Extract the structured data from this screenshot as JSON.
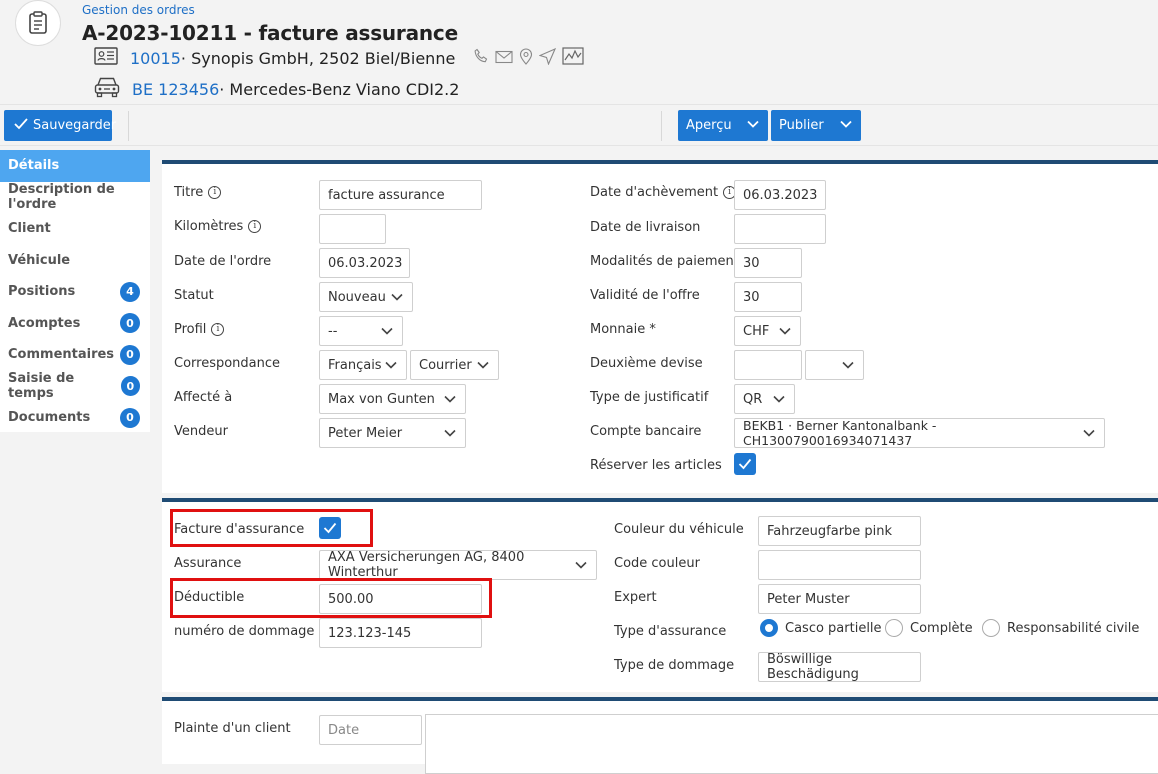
{
  "header": {
    "breadcrumb": "Gestion des ordres",
    "title": "A-2023-10211 - facture assurance",
    "client_number": "10015",
    "client_name": " · Synopis GmbH, 2502 Biel/Bienne",
    "vehicle_plate": "BE 123456",
    "vehicle_name": " · Mercedes-Benz Viano CDI2.2"
  },
  "toolbar": {
    "save_label": "Sauvegarder",
    "preview_label": "Aperçu",
    "publish_label": "Publier"
  },
  "sidebar": {
    "items": [
      {
        "label": "Détails",
        "badge": ""
      },
      {
        "label": "Description de l'ordre",
        "badge": ""
      },
      {
        "label": "Client",
        "badge": ""
      },
      {
        "label": "Véhicule",
        "badge": ""
      },
      {
        "label": "Positions",
        "badge": "4"
      },
      {
        "label": "Acomptes",
        "badge": "0"
      },
      {
        "label": "Commentaires",
        "badge": "0"
      },
      {
        "label": "Saisie de temps",
        "badge": "0"
      },
      {
        "label": "Documents",
        "badge": "0"
      }
    ]
  },
  "details": {
    "titre_label": "Titre",
    "titre_value": "facture assurance",
    "km_label": "Kilomètres",
    "km_value": "",
    "date_ordre_label": "Date de l'ordre",
    "date_ordre_value": "06.03.2023",
    "statut_label": "Statut",
    "statut_value": "Nouveau",
    "profil_label": "Profil",
    "profil_value": "--",
    "corresp_label": "Correspondance",
    "corresp_lang": "Français",
    "corresp_mode": "Courrier",
    "affecte_label": "Affecté à",
    "affecte_value": "Max von Gunten",
    "vendeur_label": "Vendeur",
    "vendeur_value": "Peter Meier",
    "date_ach_label": "Date d'achèvement",
    "date_ach_value": "06.03.2023",
    "date_liv_label": "Date de livraison",
    "date_liv_value": "",
    "modalites_label": "Modalités de paiement",
    "modalites_value": "30",
    "validite_label": "Validité de l'offre",
    "validite_value": "30",
    "monnaie_label": "Monnaie *",
    "monnaie_value": "CHF",
    "devise2_label": "Deuxième devise",
    "devise2_value": "",
    "devise2_select": "",
    "justif_label": "Type de justificatif",
    "justif_value": "QR",
    "compte_label": "Compte bancaire",
    "compte_value": "BEKB1 · Berner Kantonalbank - CH1300790016934071437",
    "reserver_label": "Réserver les articles"
  },
  "insurance": {
    "facture_label": "Facture d'assurance",
    "assurance_label": "Assurance",
    "assurance_value": "AXA Versicherungen AG, 8400 Winterthur",
    "deductible_label": "Déductible",
    "deductible_value": "500.00",
    "dommage_num_label": "numéro de dommage",
    "dommage_num_value": "123.123-145",
    "couleur_label": "Couleur du véhicule",
    "couleur_value": "Fahrzeugfarbe pink",
    "code_couleur_label": "Code couleur",
    "code_couleur_value": "",
    "expert_label": "Expert",
    "expert_value": "Peter Muster",
    "type_assurance_label": "Type d'assurance",
    "type_options": [
      "Casco partielle",
      "Complète",
      "Responsabilité civile"
    ],
    "type_dommage_label": "Type de dommage",
    "type_dommage_value": "Böswillige Beschädigung"
  },
  "complaint": {
    "label": "Plainte d'un client",
    "date_placeholder": "Date"
  },
  "colors": {
    "accent": "#1e78d2",
    "sidebar_active": "#4ea6f0",
    "panel_border": "#1f4b74",
    "highlight": "#e01010",
    "link": "#1e6fc6"
  }
}
